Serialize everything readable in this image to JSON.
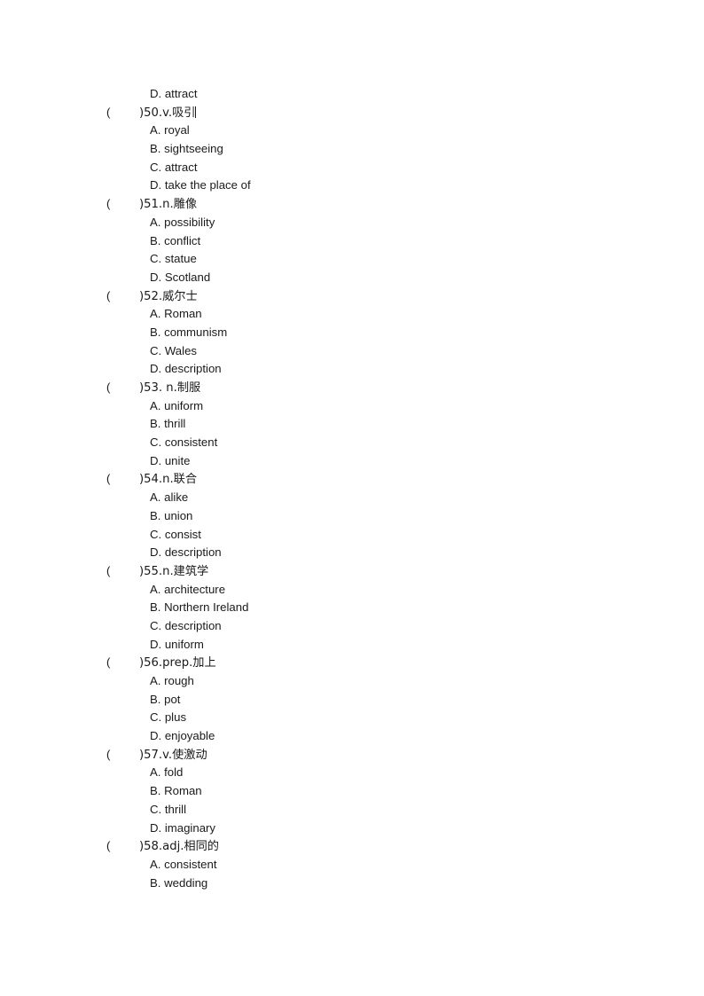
{
  "document": {
    "type": "vocabulary-multiple-choice-worksheet",
    "page_background": "#ffffff",
    "text_color": "#1a1a1a",
    "orphan_option_top": "D. attract",
    "marker_open": "(",
    "marker_close": ")"
  },
  "questions": [
    {
      "number": "50",
      "stem": ")50.v.吸引",
      "has_caret": true,
      "options": [
        "A. royal",
        "B. sightseeing",
        "C. attract",
        "D. take the place of"
      ]
    },
    {
      "number": "51",
      "stem": ")51.n.雕像",
      "has_caret": false,
      "options": [
        "A. possibility",
        "B. conflict",
        "C. statue",
        "D. Scotland"
      ]
    },
    {
      "number": "52",
      "stem": ")52.威尔士",
      "has_caret": false,
      "options": [
        "A. Roman",
        "B. communism",
        "C. Wales",
        "D. description"
      ]
    },
    {
      "number": "53",
      "stem": ")53. n.制服",
      "has_caret": false,
      "options": [
        "A. uniform",
        "B. thrill",
        "C. consistent",
        "D. unite"
      ]
    },
    {
      "number": "54",
      "stem": ")54.n.联合",
      "has_caret": false,
      "options": [
        "A. alike",
        "B. union",
        "C. consist",
        "D. description"
      ]
    },
    {
      "number": "55",
      "stem": ")55.n.建筑学",
      "has_caret": false,
      "options": [
        "A. architecture",
        "B. Northern Ireland",
        "C. description",
        "D. uniform"
      ]
    },
    {
      "number": "56",
      "stem": ")56.prep.加上",
      "has_caret": false,
      "options": [
        "A. rough",
        "B. pot",
        "C. plus",
        "D. enjoyable"
      ]
    },
    {
      "number": "57",
      "stem": ")57.v.使激动",
      "has_caret": false,
      "options": [
        "A. fold",
        "B. Roman",
        "C. thrill",
        "D. imaginary"
      ]
    },
    {
      "number": "58",
      "stem": ")58.adj.相同的",
      "has_caret": false,
      "options": [
        "A. consistent",
        "B. wedding"
      ]
    }
  ]
}
